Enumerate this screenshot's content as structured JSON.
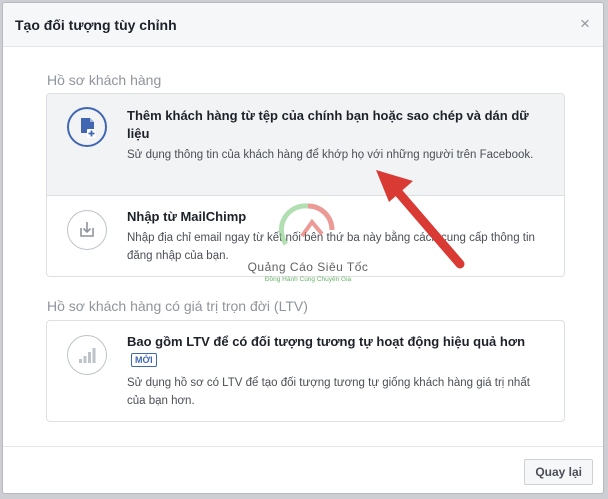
{
  "dialog": {
    "title": "Tạo đối tượng tùy chỉnh",
    "close_label": "×"
  },
  "sections": [
    {
      "title": "Hồ sơ khách hàng",
      "options": [
        {
          "title": "Thêm khách hàng từ tệp của chính bạn hoặc sao chép và dán dữ liệu",
          "description": "Sử dụng thông tin của khách hàng để khớp họ với những người trên Facebook.",
          "icon": "file-add-icon",
          "selected": true
        },
        {
          "title": "Nhập từ MailChimp",
          "description": "Nhập địa chỉ email ngay từ kết nối bên thứ ba này bằng cách cung cấp thông tin đăng nhập của bạn.",
          "icon": "import-icon",
          "selected": false
        }
      ]
    },
    {
      "title": "Hồ sơ khách hàng có giá trị trọn đời (LTV)",
      "options": [
        {
          "title": "Bao gồm LTV để có đối tượng tương tự hoạt động hiệu quả hơn",
          "badge": "MỚI",
          "description": "Sử dụng hồ sơ có LTV để tạo đối tượng tương tự giống khách hàng giá trị nhất của bạn hơn.",
          "icon": "signal-bars-icon",
          "selected": false
        }
      ]
    }
  ],
  "footer": {
    "back_label": "Quay lại"
  },
  "watermark": {
    "brand": "Quảng Cáo Siêu Tốc",
    "tagline": "Đồng Hành Cùng Chuyên Gia"
  },
  "colors": {
    "accent": "#4267b2",
    "arrow": "#e0443a",
    "selected_bg": "#f2f3f5"
  }
}
